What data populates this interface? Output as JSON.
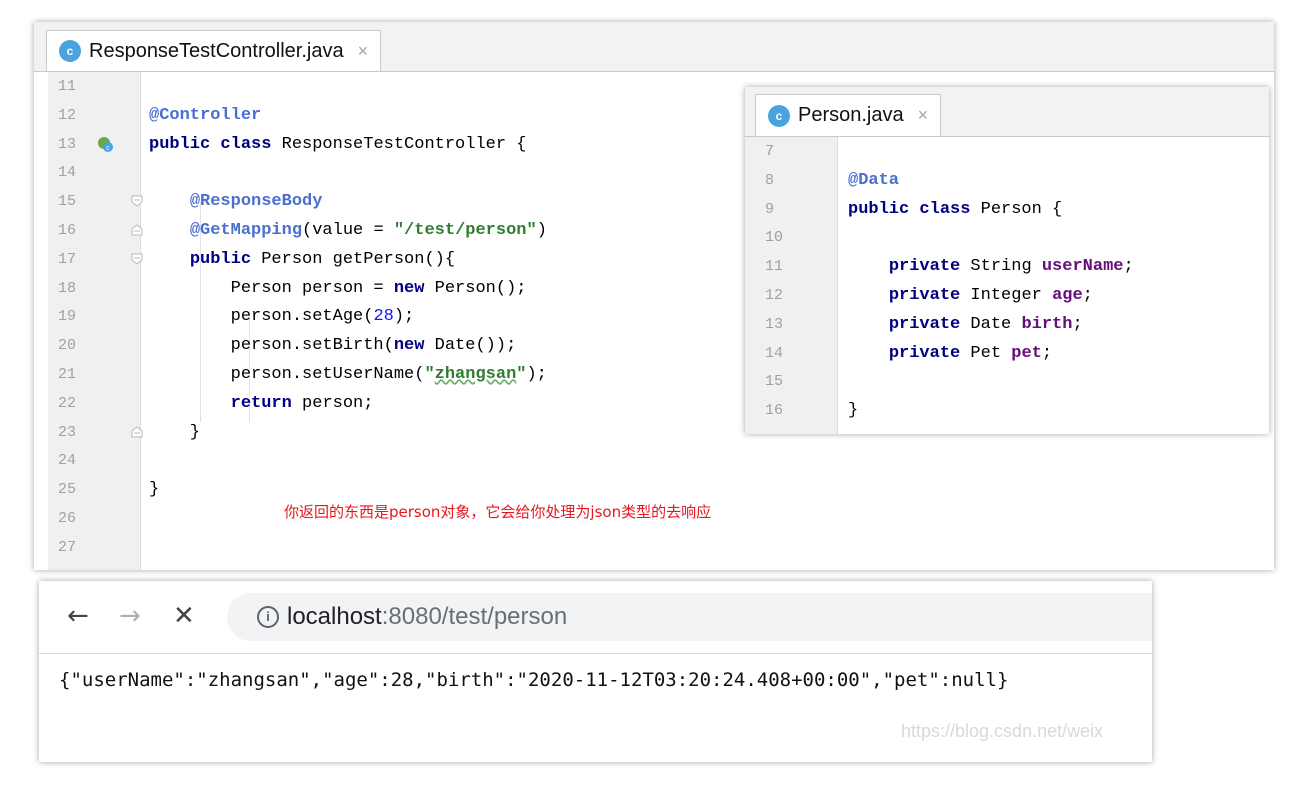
{
  "controller_file": {
    "tab_label": "ResponseTestController.java",
    "tab_icon": "class-c-icon",
    "lines": [
      {
        "n": "11",
        "html": ""
      },
      {
        "n": "12",
        "html": "<span class='ann'>@Controller</span>"
      },
      {
        "n": "13",
        "html": "<span class='kw'>public class</span> ResponseTestController {"
      },
      {
        "n": "14",
        "html": ""
      },
      {
        "n": "15",
        "html": "    <span class='ann'>@ResponseBody</span>"
      },
      {
        "n": "16",
        "html": "    <span class='ann'>@GetMapping</span>(value = <span class='str'>\"/test/person\"</span>)"
      },
      {
        "n": "17",
        "html": "    <span class='kw'>public</span> Person getPerson(){"
      },
      {
        "n": "18",
        "html": "        Person person = <span class='kw'>new</span> Person();"
      },
      {
        "n": "19",
        "html": "        person.setAge(<span class='num'>28</span>);"
      },
      {
        "n": "20",
        "html": "        person.setBirth(<span class='kw'>new</span> Date());"
      },
      {
        "n": "21",
        "html": "        person.setUserName(<span class='str'>\"<span class='sqg'>zhangsan</span>\"</span>);"
      },
      {
        "n": "22",
        "html": "        <span class='kw'>return</span> person;"
      },
      {
        "n": "23",
        "html": "    }"
      },
      {
        "n": "24",
        "html": ""
      },
      {
        "n": "25",
        "html": "}"
      },
      {
        "n": "26",
        "html": ""
      },
      {
        "n": "27",
        "html": ""
      }
    ],
    "note": "你返回的东西是person对象，它会给你处理为json类型的去响应"
  },
  "person_file": {
    "tab_label": "Person.java",
    "tab_icon": "class-c-icon",
    "lines": [
      {
        "n": "7",
        "html": ""
      },
      {
        "n": "8",
        "html": "<span class='ann'>@Data</span>"
      },
      {
        "n": "9",
        "html": "<span class='kw'>public class</span> Person {"
      },
      {
        "n": "10",
        "html": ""
      },
      {
        "n": "11",
        "html": "    <span class='kw'>private</span> String <span class='fld'>userName</span>;"
      },
      {
        "n": "12",
        "html": "    <span class='kw'>private</span> Integer <span class='fld'>age</span>;"
      },
      {
        "n": "13",
        "html": "    <span class='kw'>private</span> Date <span class='fld'>birth</span>;"
      },
      {
        "n": "14",
        "html": "    <span class='kw'>private</span> Pet <span class='fld'>pet</span>;"
      },
      {
        "n": "15",
        "html": ""
      },
      {
        "n": "16",
        "html": "}"
      }
    ]
  },
  "browser": {
    "back_label": "←",
    "forward_label": "→",
    "stop_label": "✕",
    "url_host": "localhost",
    "url_rest": ":8080/test/person",
    "response_body": "{\"userName\":\"zhangsan\",\"age\":28,\"birth\":\"2020-11-12T03:20:24.408+00:00\",\"pet\":null}",
    "watermark": "https://blog.csdn.net/weix"
  },
  "colors": {
    "annotation": "#4a6fd0",
    "keyword": "#000080",
    "string": "#2f7e2f",
    "number": "#1414ff",
    "note_red": "#e8161e"
  }
}
